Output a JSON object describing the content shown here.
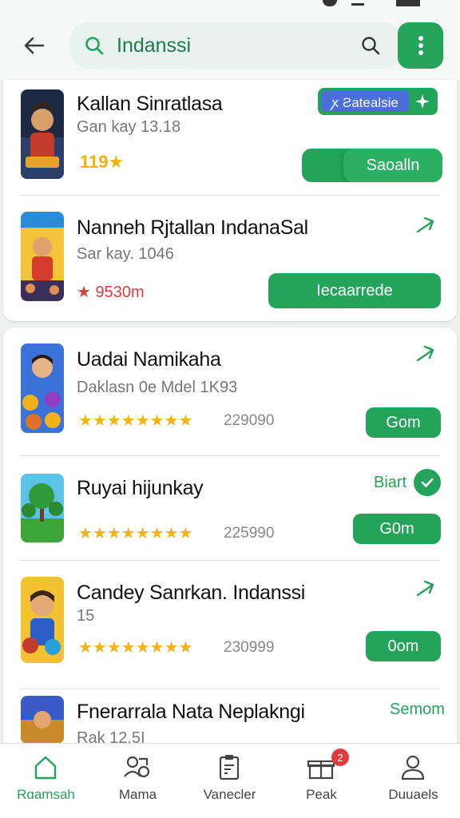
{
  "search": {
    "value": "Indanssi"
  },
  "apps_top": [
    {
      "title": "Kallan Sinratlasa",
      "subtitle": "Gan kay  13.18",
      "rating": "119★",
      "badge_label": "ꭗ Ƨatealsie",
      "button_label": "Saoalln"
    },
    {
      "title": "Nanneh Rjtallan IndanaSal",
      "subtitle": "Sar kay. 1046",
      "rating": "★ 9530m",
      "button_label": "Iecaarrede"
    }
  ],
  "apps_bottom": [
    {
      "title": "Uadai Namikaha",
      "subtitle": "Daklasn 0e Mdel 1K93",
      "stars": "★★★★★★★★",
      "count": "229090",
      "button_label": "Gom"
    },
    {
      "title": "Ruyai hijunkay",
      "status_label": "Biart",
      "stars": "★★★★★★★★",
      "count": "225990",
      "button_label": "G0m"
    },
    {
      "title": "Candey Sanrkan. Indanssi",
      "subtitle": "15",
      "stars": "★★★★★★★★",
      "count": "230999",
      "button_label": "0om"
    },
    {
      "title": "Fnerarrala Nata Neplakngi",
      "subtitle": "Rak 12.5I",
      "link_label": "Semom"
    }
  ],
  "bottom_nav": [
    {
      "label": "Rɑamsah",
      "icon": "home-icon"
    },
    {
      "label": "Mama",
      "icon": "people-icon"
    },
    {
      "label": "Vanecler",
      "icon": "clipboard-icon"
    },
    {
      "label": "Peak",
      "icon": "gift-icon",
      "badge": "2"
    },
    {
      "label": "Duuaels",
      "icon": "profile-icon"
    }
  ],
  "colors": {
    "accent": "#23a45a",
    "star": "#f2b21a",
    "alert": "#e23b3b"
  }
}
